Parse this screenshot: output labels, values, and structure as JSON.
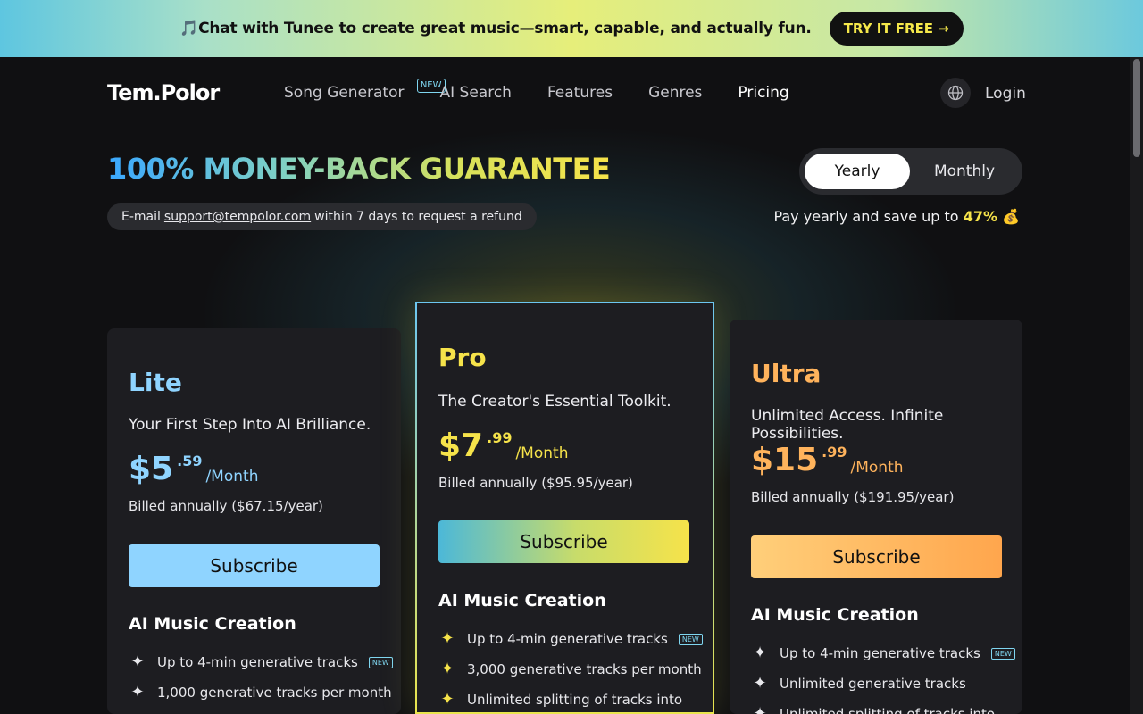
{
  "promo": {
    "text": "🎵Chat with Tunee to create great music—smart, capable, and actually fun.",
    "button": "TRY IT FREE →"
  },
  "nav": {
    "logo": "Tem.Polor",
    "links": [
      "Song Generator",
      "AI Search",
      "Features",
      "Genres",
      "Pricing"
    ],
    "new_badge": "NEW",
    "login": "Login"
  },
  "guarantee": {
    "title": "100% MONEY-BACK GUARANTEE",
    "refund_prefix": "E-mail",
    "email": "support@tempolor.com",
    "refund_suffix": "within 7 days to request a refund"
  },
  "billing_toggle": {
    "yearly": "Yearly",
    "monthly": "Monthly",
    "selected": "Yearly",
    "save_text": "Pay yearly and save up to",
    "save_pct": "47%",
    "save_icon": "💰"
  },
  "plans": [
    {
      "name": "Lite",
      "color": "#8fd4ff",
      "desc": "Your First Step Into AI Brilliance.",
      "price_whole": "$5",
      "price_cents": ".59",
      "per": "/Month",
      "billed": "Billed annually ($67.15/year)",
      "button": "Subscribe",
      "section": "AI Music Creation",
      "features": [
        "Up to 4-min generative tracks",
        "1,000 generative tracks per month"
      ]
    },
    {
      "name": "Pro",
      "color": "#f6e34a",
      "desc": "The Creator's Essential Toolkit.",
      "price_whole": "$7",
      "price_cents": ".99",
      "per": "/Month",
      "billed": "Billed annually ($95.95/year)",
      "button": "Subscribe",
      "section": "AI Music Creation",
      "features": [
        "Up to 4-min generative tracks",
        "3,000 generative tracks per month",
        "Unlimited splitting of tracks into"
      ]
    },
    {
      "name": "Ultra",
      "color": "#ffb35c",
      "desc": "Unlimited Access. Infinite Possibilities.",
      "price_whole": "$15",
      "price_cents": ".99",
      "per": "/Month",
      "billed": "Billed annually ($191.95/year)",
      "button": "Subscribe",
      "section": "AI Music Creation",
      "features": [
        "Up to 4-min generative tracks",
        "Unlimited generative tracks",
        "Unlimited splitting of tracks into"
      ]
    }
  ],
  "feature_new_badge": "NEW"
}
